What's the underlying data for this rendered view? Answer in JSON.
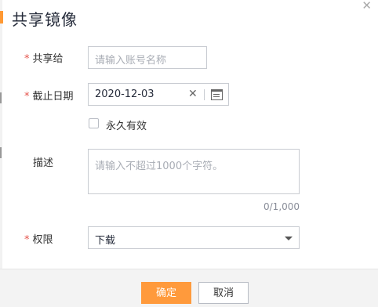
{
  "dialog": {
    "title": "共享镜像",
    "close_icon": "close-icon",
    "accent_color": "#ff9933",
    "required_mark": "*"
  },
  "form": {
    "share_to": {
      "label": "共享给",
      "placeholder": "请输入账号名称",
      "value": ""
    },
    "expiry_date": {
      "label": "截止日期",
      "value": "2020-12-03",
      "clear_glyph": "✕",
      "calendar_icon": "calendar-icon"
    },
    "permanent": {
      "label": "永久有效",
      "checked": false
    },
    "description": {
      "label": "描述",
      "placeholder": "请输入不超过1000个字符。",
      "counter": "0/1,000"
    },
    "permission": {
      "label": "权限",
      "value": "下载"
    }
  },
  "footer": {
    "confirm_label": "确定",
    "cancel_label": "取消",
    "primary_color": "#ff9a3c"
  }
}
